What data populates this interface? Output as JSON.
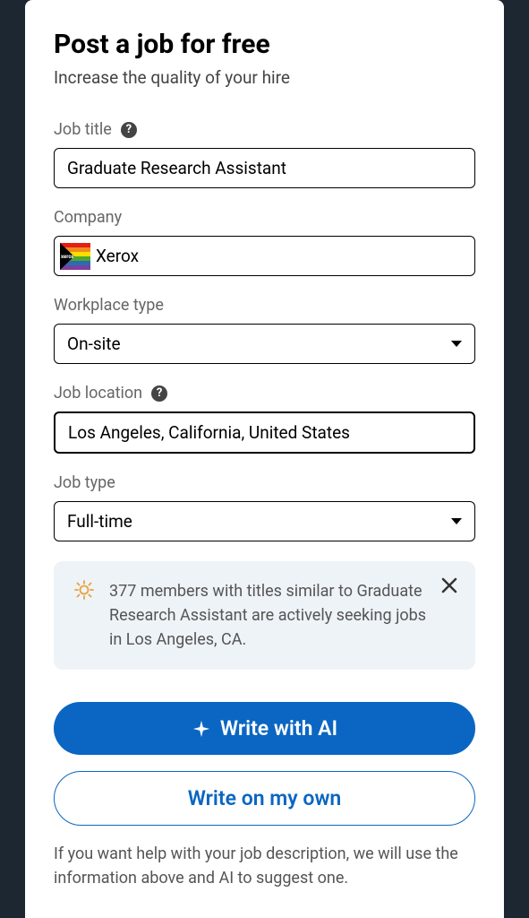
{
  "header": {
    "title": "Post a job for free",
    "subtitle": "Increase the quality of your hire"
  },
  "fields": {
    "job_title": {
      "label": "Job title",
      "value": "Graduate Research Assistant"
    },
    "company": {
      "label": "Company",
      "value": "Xerox"
    },
    "workplace_type": {
      "label": "Workplace type",
      "value": "On-site"
    },
    "job_location": {
      "label": "Job location",
      "value": "Los Angeles, California, United States"
    },
    "job_type": {
      "label": "Job type",
      "value": "Full-time"
    }
  },
  "info": {
    "text": "377 members with titles similar to Graduate Research Assistant are actively seeking jobs in Los Angeles, CA."
  },
  "buttons": {
    "write_ai": "Write with AI",
    "write_own": "Write on my own"
  },
  "footer": {
    "text": "If you want help with your job description, we will use the information above and AI to suggest one."
  }
}
